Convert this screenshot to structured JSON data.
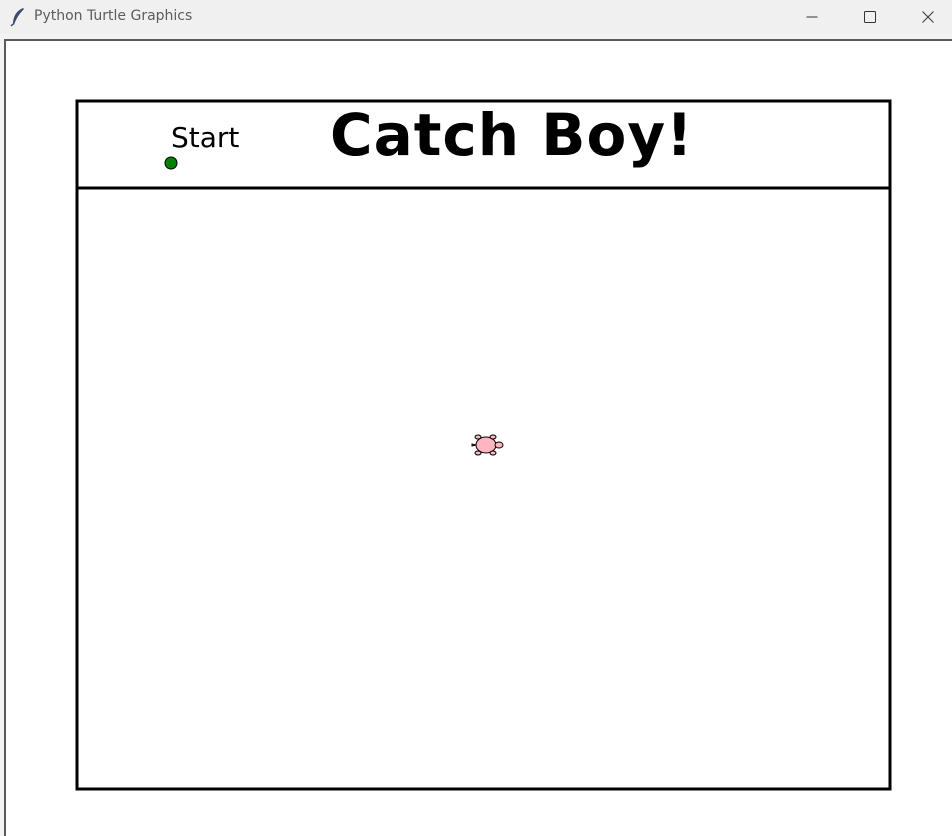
{
  "window": {
    "title": "Python Turtle Graphics",
    "app_icon": "feather-icon",
    "controls": {
      "minimize_icon": "minimize-icon",
      "maximize_icon": "maximize-icon",
      "close_icon": "close-icon"
    }
  },
  "game": {
    "title": "Catch Boy!",
    "start_label": "Start",
    "start_dot_color": "#008000",
    "turtle_color": "#ffb6c1",
    "turtle_icon": "turtle-icon"
  }
}
